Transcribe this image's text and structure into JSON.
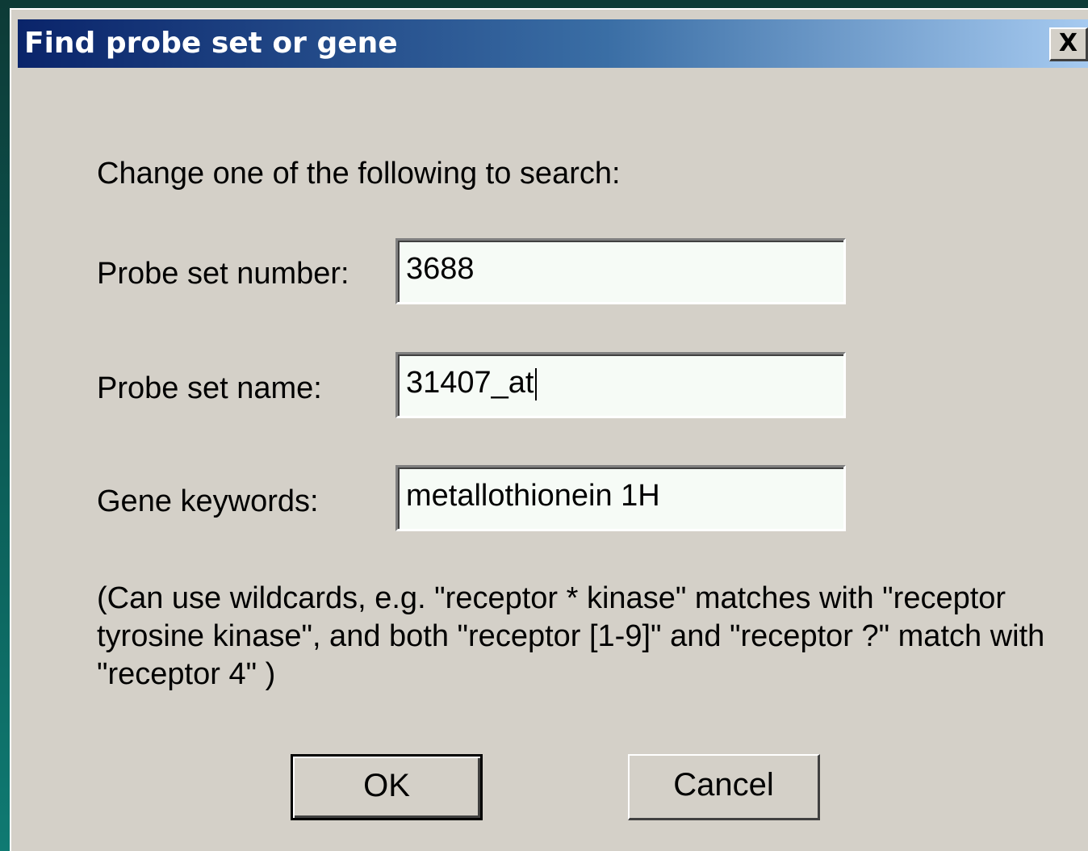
{
  "window": {
    "title": "Find probe set or gene",
    "close_label": "X"
  },
  "instruction": "Change one of the following to search:",
  "fields": {
    "probe_set_number": {
      "label": "Probe set number:",
      "value": "3688"
    },
    "probe_set_name": {
      "label": "Probe set name:",
      "value": "31407_at"
    },
    "gene_keywords": {
      "label": "Gene keywords:",
      "value": "metallothionein 1H"
    }
  },
  "hint": "(Can use wildcards, e.g. \"receptor * kinase\" matches with \"receptor tyrosine kinase\", and both \"receptor [1-9]\" and \"receptor ?\" match with \"receptor 4\" )",
  "buttons": {
    "ok": "OK",
    "cancel": "Cancel"
  },
  "colors": {
    "dialog_background": "#d4d0c8",
    "titlebar_start": "#0a246a",
    "titlebar_end": "#a6caf0",
    "field_background": "#f6fbf6"
  }
}
